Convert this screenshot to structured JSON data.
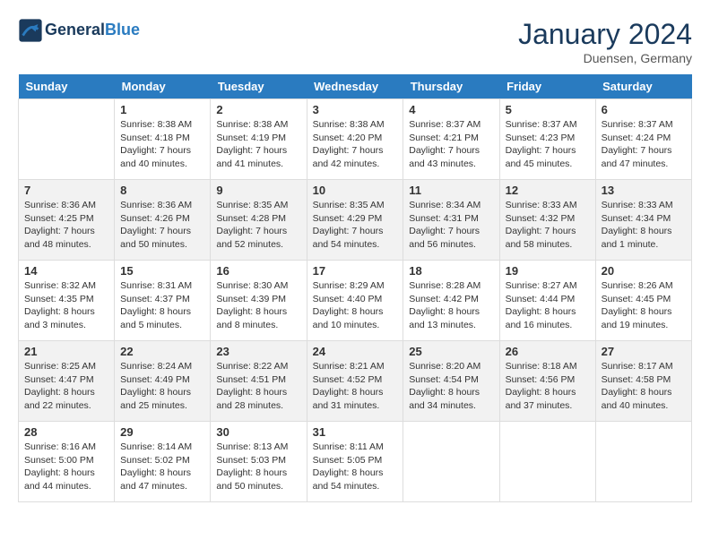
{
  "header": {
    "logo_line1": "General",
    "logo_line2": "Blue",
    "month_title": "January 2024",
    "location": "Duensen, Germany"
  },
  "days_of_week": [
    "Sunday",
    "Monday",
    "Tuesday",
    "Wednesday",
    "Thursday",
    "Friday",
    "Saturday"
  ],
  "weeks": [
    [
      {
        "day": "",
        "empty": true
      },
      {
        "day": "1",
        "sunrise": "8:38 AM",
        "sunset": "4:18 PM",
        "daylight": "7 hours and 40 minutes."
      },
      {
        "day": "2",
        "sunrise": "8:38 AM",
        "sunset": "4:19 PM",
        "daylight": "7 hours and 41 minutes."
      },
      {
        "day": "3",
        "sunrise": "8:38 AM",
        "sunset": "4:20 PM",
        "daylight": "7 hours and 42 minutes."
      },
      {
        "day": "4",
        "sunrise": "8:37 AM",
        "sunset": "4:21 PM",
        "daylight": "7 hours and 43 minutes."
      },
      {
        "day": "5",
        "sunrise": "8:37 AM",
        "sunset": "4:23 PM",
        "daylight": "7 hours and 45 minutes."
      },
      {
        "day": "6",
        "sunrise": "8:37 AM",
        "sunset": "4:24 PM",
        "daylight": "7 hours and 47 minutes."
      }
    ],
    [
      {
        "day": "7",
        "sunrise": "8:36 AM",
        "sunset": "4:25 PM",
        "daylight": "7 hours and 48 minutes."
      },
      {
        "day": "8",
        "sunrise": "8:36 AM",
        "sunset": "4:26 PM",
        "daylight": "7 hours and 50 minutes."
      },
      {
        "day": "9",
        "sunrise": "8:35 AM",
        "sunset": "4:28 PM",
        "daylight": "7 hours and 52 minutes."
      },
      {
        "day": "10",
        "sunrise": "8:35 AM",
        "sunset": "4:29 PM",
        "daylight": "7 hours and 54 minutes."
      },
      {
        "day": "11",
        "sunrise": "8:34 AM",
        "sunset": "4:31 PM",
        "daylight": "7 hours and 56 minutes."
      },
      {
        "day": "12",
        "sunrise": "8:33 AM",
        "sunset": "4:32 PM",
        "daylight": "7 hours and 58 minutes."
      },
      {
        "day": "13",
        "sunrise": "8:33 AM",
        "sunset": "4:34 PM",
        "daylight": "8 hours and 1 minute."
      }
    ],
    [
      {
        "day": "14",
        "sunrise": "8:32 AM",
        "sunset": "4:35 PM",
        "daylight": "8 hours and 3 minutes."
      },
      {
        "day": "15",
        "sunrise": "8:31 AM",
        "sunset": "4:37 PM",
        "daylight": "8 hours and 5 minutes."
      },
      {
        "day": "16",
        "sunrise": "8:30 AM",
        "sunset": "4:39 PM",
        "daylight": "8 hours and 8 minutes."
      },
      {
        "day": "17",
        "sunrise": "8:29 AM",
        "sunset": "4:40 PM",
        "daylight": "8 hours and 10 minutes."
      },
      {
        "day": "18",
        "sunrise": "8:28 AM",
        "sunset": "4:42 PM",
        "daylight": "8 hours and 13 minutes."
      },
      {
        "day": "19",
        "sunrise": "8:27 AM",
        "sunset": "4:44 PM",
        "daylight": "8 hours and 16 minutes."
      },
      {
        "day": "20",
        "sunrise": "8:26 AM",
        "sunset": "4:45 PM",
        "daylight": "8 hours and 19 minutes."
      }
    ],
    [
      {
        "day": "21",
        "sunrise": "8:25 AM",
        "sunset": "4:47 PM",
        "daylight": "8 hours and 22 minutes."
      },
      {
        "day": "22",
        "sunrise": "8:24 AM",
        "sunset": "4:49 PM",
        "daylight": "8 hours and 25 minutes."
      },
      {
        "day": "23",
        "sunrise": "8:22 AM",
        "sunset": "4:51 PM",
        "daylight": "8 hours and 28 minutes."
      },
      {
        "day": "24",
        "sunrise": "8:21 AM",
        "sunset": "4:52 PM",
        "daylight": "8 hours and 31 minutes."
      },
      {
        "day": "25",
        "sunrise": "8:20 AM",
        "sunset": "4:54 PM",
        "daylight": "8 hours and 34 minutes."
      },
      {
        "day": "26",
        "sunrise": "8:18 AM",
        "sunset": "4:56 PM",
        "daylight": "8 hours and 37 minutes."
      },
      {
        "day": "27",
        "sunrise": "8:17 AM",
        "sunset": "4:58 PM",
        "daylight": "8 hours and 40 minutes."
      }
    ],
    [
      {
        "day": "28",
        "sunrise": "8:16 AM",
        "sunset": "5:00 PM",
        "daylight": "8 hours and 44 minutes."
      },
      {
        "day": "29",
        "sunrise": "8:14 AM",
        "sunset": "5:02 PM",
        "daylight": "8 hours and 47 minutes."
      },
      {
        "day": "30",
        "sunrise": "8:13 AM",
        "sunset": "5:03 PM",
        "daylight": "8 hours and 50 minutes."
      },
      {
        "day": "31",
        "sunrise": "8:11 AM",
        "sunset": "5:05 PM",
        "daylight": "8 hours and 54 minutes."
      },
      {
        "day": "",
        "empty": true
      },
      {
        "day": "",
        "empty": true
      },
      {
        "day": "",
        "empty": true
      }
    ]
  ],
  "labels": {
    "sunrise_prefix": "Sunrise: ",
    "sunset_prefix": "Sunset: ",
    "daylight_prefix": "Daylight: "
  }
}
